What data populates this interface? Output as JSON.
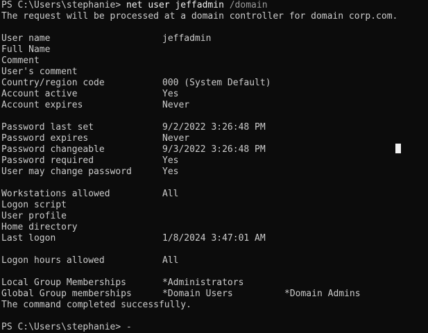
{
  "prompt": {
    "path": "PS C:\\Users\\stephanie> ",
    "command": "net user jeffadmin",
    "flag": " /domain"
  },
  "notice": "The request will be processed at a domain controller for domain corp.com.",
  "account": [
    {
      "label": "User name",
      "value": "jeffadmin"
    },
    {
      "label": "Full Name",
      "value": ""
    },
    {
      "label": "Comment",
      "value": ""
    },
    {
      "label": "User's comment",
      "value": ""
    },
    {
      "label": "Country/region code",
      "value": "000 (System Default)"
    },
    {
      "label": "Account active",
      "value": "Yes"
    },
    {
      "label": "Account expires",
      "value": "Never"
    }
  ],
  "password": [
    {
      "label": "Password last set",
      "value": "9/2/2022 3:26:48 PM"
    },
    {
      "label": "Password expires",
      "value": "Never"
    },
    {
      "label": "Password changeable",
      "value": "9/3/2022 3:26:48 PM"
    },
    {
      "label": "Password required",
      "value": "Yes"
    },
    {
      "label": "User may change password",
      "value": "Yes"
    }
  ],
  "logon": [
    {
      "label": "Workstations allowed",
      "value": "All"
    },
    {
      "label": "Logon script",
      "value": ""
    },
    {
      "label": "User profile",
      "value": ""
    },
    {
      "label": "Home directory",
      "value": ""
    },
    {
      "label": "Last logon",
      "value": "1/8/2024 3:47:01 AM"
    }
  ],
  "hours": {
    "label": "Logon hours allowed",
    "value": "All"
  },
  "groups": {
    "local_label": "Local Group Memberships",
    "local_value": "*Administrators",
    "global_label": "Global Group memberships",
    "global_value1": "*Domain Users",
    "global_value2": "*Domain Admins"
  },
  "completion": "The command completed successfully.",
  "final_prompt": {
    "path": "PS C:\\Users\\stephanie>",
    "input": " -"
  }
}
